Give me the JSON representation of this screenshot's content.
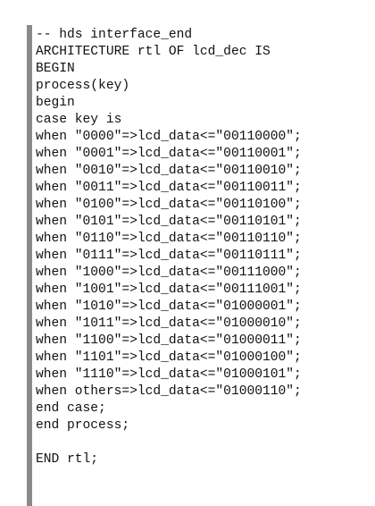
{
  "code": {
    "lines": [
      "-- hds interface_end",
      "ARCHITECTURE rtl OF lcd_dec IS",
      "BEGIN",
      "process(key)",
      "begin",
      "case key is",
      "when \"0000\"=>lcd_data<=\"00110000\";",
      "when \"0001\"=>lcd_data<=\"00110001\";",
      "when \"0010\"=>lcd_data<=\"00110010\";",
      "when \"0011\"=>lcd_data<=\"00110011\";",
      "when \"0100\"=>lcd_data<=\"00110100\";",
      "when \"0101\"=>lcd_data<=\"00110101\";",
      "when \"0110\"=>lcd_data<=\"00110110\";",
      "when \"0111\"=>lcd_data<=\"00110111\";",
      "when \"1000\"=>lcd_data<=\"00111000\";",
      "when \"1001\"=>lcd_data<=\"00111001\";",
      "when \"1010\"=>lcd_data<=\"01000001\";",
      "when \"1011\"=>lcd_data<=\"01000010\";",
      "when \"1100\"=>lcd_data<=\"01000011\";",
      "when \"1101\"=>lcd_data<=\"01000100\";",
      "when \"1110\"=>lcd_data<=\"01000101\";",
      "when others=>lcd_data<=\"01000110\";",
      "end case;",
      "end process;",
      "",
      "END rtl;"
    ]
  }
}
